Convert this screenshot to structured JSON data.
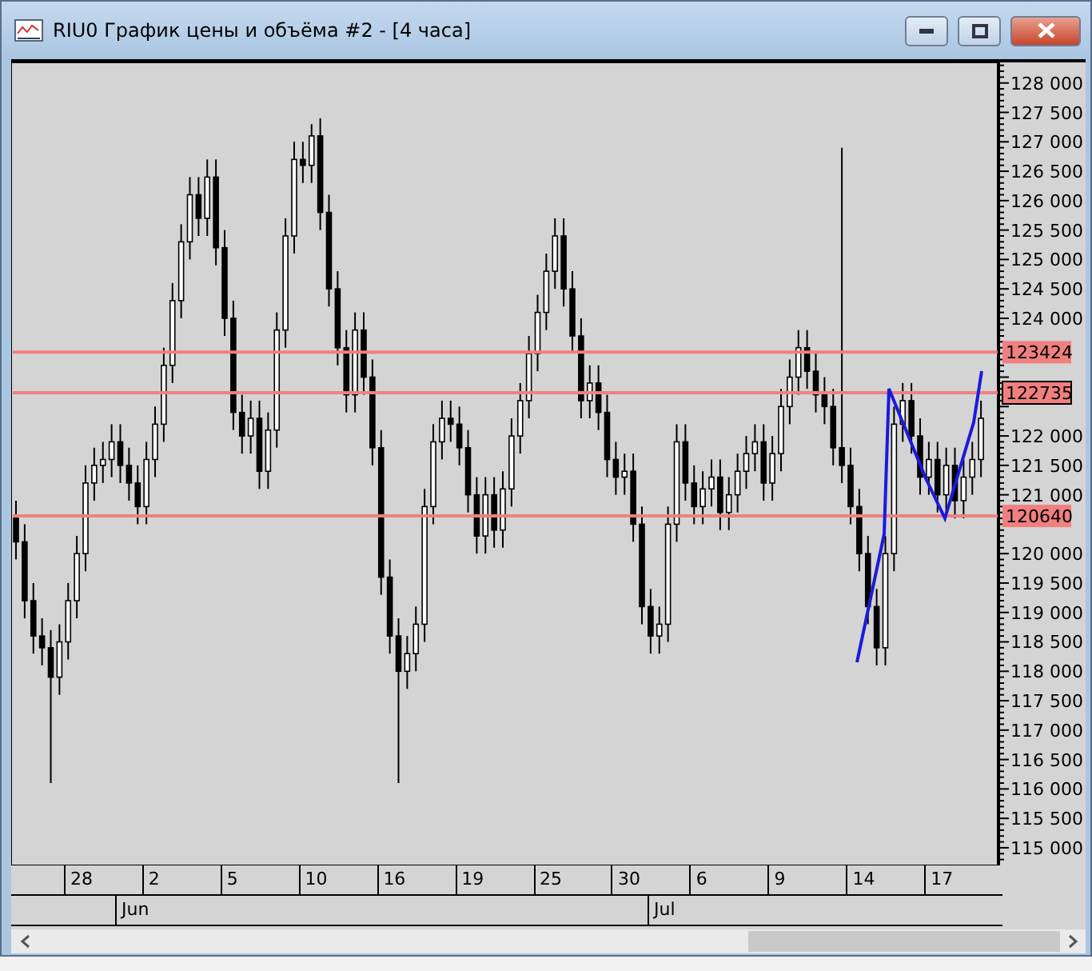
{
  "window": {
    "title": "RIU0 График цены и объёма #2 - [4 часа]"
  },
  "chart": {
    "chart_data": {
      "type": "candlestick",
      "ylim": [
        114700,
        128350
      ],
      "yticks": [
        {
          "value": 128000,
          "label": "128 000"
        },
        {
          "value": 127500,
          "label": "127 500"
        },
        {
          "value": 127000,
          "label": "127 000"
        },
        {
          "value": 126500,
          "label": "126 500"
        },
        {
          "value": 126000,
          "label": "126 000"
        },
        {
          "value": 125500,
          "label": "125 500"
        },
        {
          "value": 125000,
          "label": "125 000"
        },
        {
          "value": 124500,
          "label": "124 500"
        },
        {
          "value": 124000,
          "label": "124 000"
        },
        {
          "value": 122000,
          "label": "122 000"
        },
        {
          "value": 121500,
          "label": "121 500"
        },
        {
          "value": 121000,
          "label": "121 000"
        },
        {
          "value": 120000,
          "label": "120 000"
        },
        {
          "value": 119500,
          "label": "119 500"
        },
        {
          "value": 119000,
          "label": "119 000"
        },
        {
          "value": 118500,
          "label": "118 500"
        },
        {
          "value": 118000,
          "label": "118 000"
        },
        {
          "value": 117500,
          "label": "117 500"
        },
        {
          "value": 117000,
          "label": "117 000"
        },
        {
          "value": 116500,
          "label": "116 500"
        },
        {
          "value": 116000,
          "label": "116 000"
        },
        {
          "value": 115500,
          "label": "115 500"
        },
        {
          "value": 115000,
          "label": "115 000"
        }
      ],
      "ohlc": [
        [
          120600,
          120900,
          119900,
          120200
        ],
        [
          120200,
          120500,
          118900,
          119200
        ],
        [
          119200,
          119500,
          118300,
          118600
        ],
        [
          118600,
          118900,
          118100,
          118400
        ],
        [
          118400,
          118700,
          116100,
          117900
        ],
        [
          117900,
          118800,
          117600,
          118500
        ],
        [
          118500,
          119500,
          118200,
          119200
        ],
        [
          119200,
          120300,
          118900,
          120000
        ],
        [
          120000,
          121500,
          119700,
          121200
        ],
        [
          121200,
          121800,
          120900,
          121500
        ],
        [
          121500,
          121900,
          121200,
          121600
        ],
        [
          121600,
          122200,
          121300,
          121900
        ],
        [
          121900,
          122200,
          121200,
          121500
        ],
        [
          121500,
          121800,
          120900,
          121200
        ],
        [
          121200,
          121500,
          120500,
          120800
        ],
        [
          120800,
          121900,
          120500,
          121600
        ],
        [
          121600,
          122500,
          121300,
          122200
        ],
        [
          122200,
          123500,
          121900,
          123200
        ],
        [
          123200,
          124600,
          122900,
          124300
        ],
        [
          124300,
          125600,
          124000,
          125300
        ],
        [
          125300,
          126400,
          125000,
          126100
        ],
        [
          126100,
          126400,
          125400,
          125700
        ],
        [
          125700,
          126700,
          125400,
          126400
        ],
        [
          126400,
          126700,
          124900,
          125200
        ],
        [
          125200,
          125500,
          123700,
          124000
        ],
        [
          124000,
          124300,
          122100,
          122400
        ],
        [
          122400,
          122700,
          121700,
          122000
        ],
        [
          122000,
          122600,
          121700,
          122300
        ],
        [
          122300,
          122600,
          121100,
          121400
        ],
        [
          121400,
          122400,
          121100,
          122100
        ],
        [
          122100,
          124100,
          121800,
          123800
        ],
        [
          123800,
          125700,
          123500,
          125400
        ],
        [
          125400,
          127000,
          125100,
          126700
        ],
        [
          126700,
          127000,
          126300,
          126600
        ],
        [
          126600,
          127300,
          126300,
          127100
        ],
        [
          127100,
          127400,
          125500,
          125800
        ],
        [
          125800,
          126100,
          124200,
          124500
        ],
        [
          124500,
          124800,
          123200,
          123500
        ],
        [
          123500,
          123800,
          122400,
          122700
        ],
        [
          122700,
          124100,
          122400,
          123800
        ],
        [
          123800,
          124100,
          122700,
          123000
        ],
        [
          123000,
          123300,
          121500,
          121800
        ],
        [
          121800,
          122100,
          119300,
          119600
        ],
        [
          119600,
          119900,
          118300,
          118600
        ],
        [
          118600,
          118900,
          116100,
          118000
        ],
        [
          118000,
          118600,
          117700,
          118300
        ],
        [
          118300,
          119100,
          118000,
          118800
        ],
        [
          118800,
          121100,
          118500,
          120800
        ],
        [
          120800,
          122200,
          120500,
          121900
        ],
        [
          121900,
          122600,
          121600,
          122300
        ],
        [
          122300,
          122600,
          121900,
          122200
        ],
        [
          122200,
          122500,
          121500,
          121800
        ],
        [
          121800,
          122100,
          120700,
          121000
        ],
        [
          121000,
          121300,
          120000,
          120300
        ],
        [
          120300,
          121300,
          120000,
          121000
        ],
        [
          121000,
          121300,
          120100,
          120400
        ],
        [
          120400,
          121400,
          120100,
          121100
        ],
        [
          121100,
          122300,
          120800,
          122000
        ],
        [
          122000,
          122900,
          121700,
          122600
        ],
        [
          122600,
          123700,
          122300,
          123400
        ],
        [
          123400,
          124400,
          123100,
          124100
        ],
        [
          124100,
          125100,
          123800,
          124800
        ],
        [
          124800,
          125700,
          124500,
          125400
        ],
        [
          125400,
          125700,
          124200,
          124500
        ],
        [
          124500,
          124800,
          123400,
          123700
        ],
        [
          123700,
          124000,
          122300,
          122600
        ],
        [
          122600,
          123200,
          122300,
          122900
        ],
        [
          122900,
          123200,
          122100,
          122400
        ],
        [
          122400,
          122700,
          121300,
          121600
        ],
        [
          121600,
          121900,
          121000,
          121300
        ],
        [
          121300,
          121700,
          121000,
          121400
        ],
        [
          121400,
          121700,
          120200,
          120500
        ],
        [
          120500,
          120800,
          118800,
          119100
        ],
        [
          119100,
          119400,
          118300,
          118600
        ],
        [
          118600,
          119100,
          118300,
          118800
        ],
        [
          118800,
          120800,
          118500,
          120500
        ],
        [
          120500,
          122200,
          120200,
          121900
        ],
        [
          121900,
          122200,
          120900,
          121200
        ],
        [
          121200,
          121500,
          120500,
          120800
        ],
        [
          120800,
          121400,
          120500,
          121100
        ],
        [
          121100,
          121600,
          120800,
          121300
        ],
        [
          121300,
          121600,
          120400,
          120700
        ],
        [
          120700,
          121300,
          120400,
          121000
        ],
        [
          121000,
          121700,
          120700,
          121400
        ],
        [
          121400,
          122000,
          121100,
          121700
        ],
        [
          121700,
          122200,
          121400,
          121900
        ],
        [
          121900,
          122200,
          120900,
          121200
        ],
        [
          121200,
          122000,
          120900,
          121700
        ],
        [
          121700,
          122800,
          121400,
          122500
        ],
        [
          122500,
          123300,
          122200,
          123000
        ],
        [
          123000,
          123800,
          122700,
          123500
        ],
        [
          123500,
          123800,
          122800,
          123100
        ],
        [
          123100,
          123400,
          122400,
          122700
        ],
        [
          122700,
          123000,
          122200,
          122500
        ],
        [
          122500,
          122800,
          121500,
          121800
        ],
        [
          121800,
          126900,
          121200,
          121500
        ],
        [
          121500,
          121800,
          120500,
          120800
        ],
        [
          120800,
          121100,
          119700,
          120000
        ],
        [
          120000,
          120300,
          118800,
          119100
        ],
        [
          119100,
          119400,
          118100,
          118400
        ],
        [
          118400,
          120300,
          118100,
          120000
        ],
        [
          120000,
          122500,
          119700,
          122200
        ],
        [
          122200,
          122900,
          121900,
          122600
        ],
        [
          122600,
          122900,
          121700,
          122000
        ],
        [
          122000,
          122300,
          121000,
          121300
        ],
        [
          121300,
          121900,
          121000,
          121600
        ],
        [
          121600,
          121900,
          120700,
          121000
        ],
        [
          121000,
          121800,
          120700,
          121500
        ],
        [
          121500,
          121800,
          120600,
          120900
        ],
        [
          120900,
          121600,
          120600,
          121300
        ],
        [
          121300,
          121900,
          121000,
          121600
        ],
        [
          121600,
          122600,
          121300,
          122300
        ]
      ]
    }
  },
  "levels": [
    {
      "label": "123424",
      "selected": false
    },
    {
      "label": "122735",
      "selected": true
    },
    {
      "label": "120640",
      "selected": false
    }
  ],
  "date_axis": {
    "days": [
      "28",
      "2",
      "5",
      "10",
      "16",
      "19",
      "25",
      "30",
      "6",
      "9",
      "14",
      "17"
    ],
    "months": [
      "Jun",
      "Jul"
    ]
  }
}
